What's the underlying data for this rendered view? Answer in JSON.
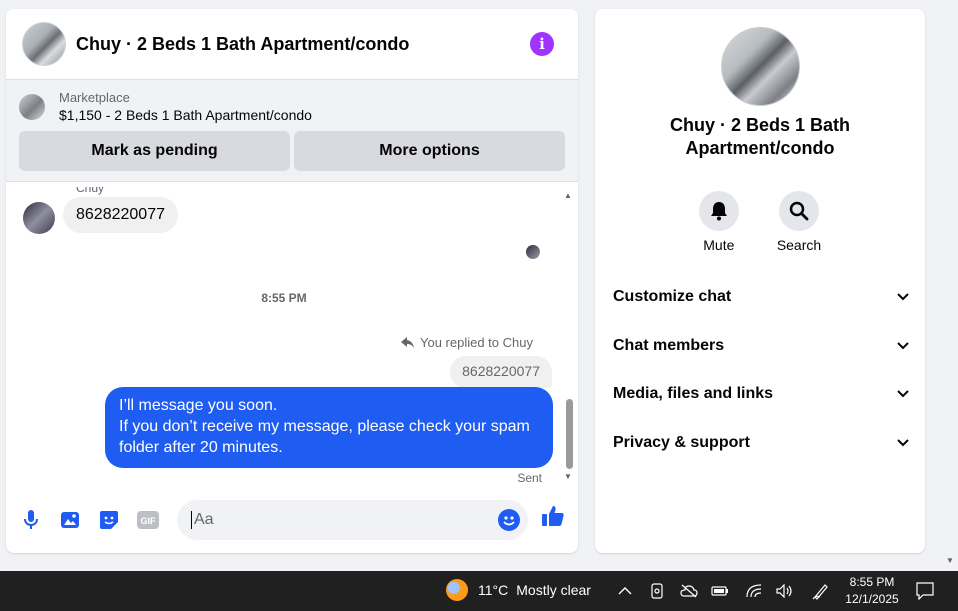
{
  "chat": {
    "title": "Chuy · 2 Beds 1 Bath Apartment/condo",
    "info_icon": "info-icon",
    "marketplace": {
      "label": "Marketplace",
      "item": "$1,150 - 2 Beds 1 Bath Apartment/condo",
      "buttons": [
        "Mark as pending",
        "More options"
      ]
    },
    "messages": {
      "sender_name": "Chuy",
      "incoming_text": "8628220077",
      "timestamp": "8:55 PM",
      "reply_note": "You replied to Chuy",
      "replied_text": "8628220077",
      "outgoing_text": "I’ll message you soon.\nIf you don’t receive my message, please check your spam folder after 20 minutes.",
      "status": "Sent"
    },
    "composer": {
      "placeholder": "Aa",
      "icons": [
        "microphone-icon",
        "photo-icon",
        "sticker-icon",
        "gif-icon",
        "emoji-icon",
        "thumbs-up-icon"
      ]
    }
  },
  "info_panel": {
    "name": "Chuy · 2 Beds 1 Bath Apartment/condo",
    "actions": [
      {
        "label": "Mute",
        "icon": "bell-icon"
      },
      {
        "label": "Search",
        "icon": "search-icon"
      }
    ],
    "sections": [
      "Customize chat",
      "Chat members",
      "Media, files and links",
      "Privacy & support"
    ]
  },
  "taskbar": {
    "weather": {
      "temp": "11°C",
      "condition": "Mostly clear"
    },
    "time": "8:55 PM",
    "date": "12/1/2025",
    "tray_icons": [
      "chevron-up-icon",
      "meet-now-icon",
      "onedrive-icon",
      "battery-icon",
      "wifi-icon",
      "volume-icon",
      "pen-icon",
      "notifications-icon"
    ]
  },
  "colors": {
    "accent": "#1f5cf2",
    "info": "#a033ff",
    "taskbar": "#202020"
  }
}
